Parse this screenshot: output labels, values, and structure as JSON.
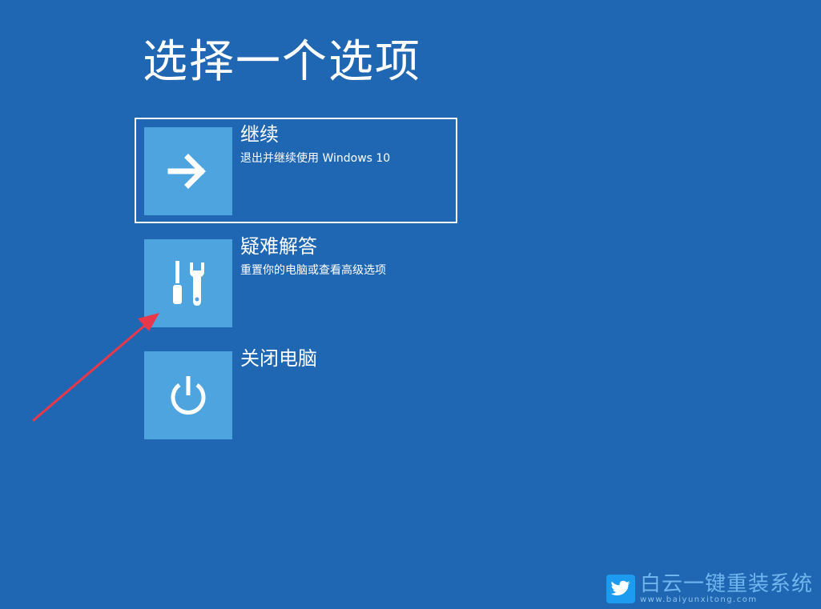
{
  "page": {
    "title": "选择一个选项"
  },
  "options": [
    {
      "label": "继续",
      "description": "退出并继续使用 Windows 10",
      "icon": "arrow-right-icon",
      "selected": true
    },
    {
      "label": "疑难解答",
      "description": "重置你的电脑或查看高级选项",
      "icon": "tools-icon",
      "selected": false
    },
    {
      "label": "关闭电脑",
      "description": "",
      "icon": "power-icon",
      "selected": false
    }
  ],
  "watermark": {
    "name": "白云一键重装系统",
    "url": "www.baiyunxitong.com"
  },
  "colors": {
    "background": "#2067b3",
    "tile": "#4ea4df",
    "annotation_arrow": "#e8384a",
    "watermark_text": "#6fb6ee"
  }
}
